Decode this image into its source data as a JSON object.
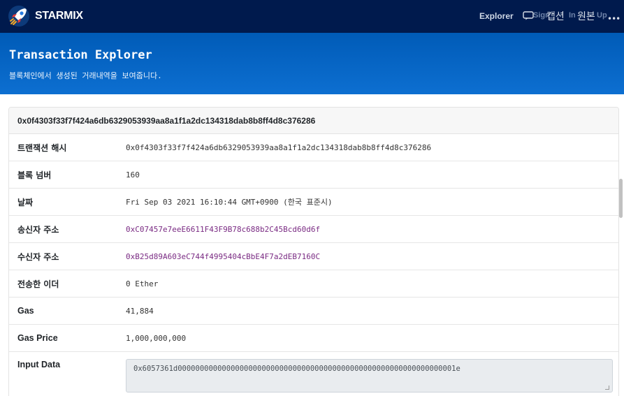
{
  "navbar": {
    "brand": "STARMIX",
    "explorer_label": "Explorer",
    "overlap_a": "Sign",
    "caption_ko": "캡션",
    "overlap_b": "In",
    "original_ko": "원본",
    "overlap_c": "Up",
    "more": "•••",
    "accent": "#001a4d"
  },
  "hero": {
    "title": "Transaction Explorer",
    "subtitle": "블록체인에서 생성된 거래내역을 보여줍니다.",
    "accent": "#0066cc"
  },
  "transaction": {
    "header": "0x0f4303f33f7f424a6db6329053939aa8a1f1a2dc134318dab8b8ff4d8c376286",
    "rows": [
      {
        "label": "트랜잭션 해시",
        "value": "0x0f4303f33f7f424a6db6329053939aa8a1f1a2dc134318dab8b8ff4d8c376286"
      },
      {
        "label": "블록 넘버",
        "value": "160"
      },
      {
        "label": "날짜",
        "value": "Fri Sep 03 2021 16:10:44 GMT+0900 (한국 표준시)"
      },
      {
        "label": "송신자 주소",
        "value": "0xC07457e7eeE6611F43F9B78c688b2C45Bcd60d6f"
      },
      {
        "label": "수신자 주소",
        "value": "0xB25d89A603eC744f4995404cBbE4F7a2dEB7160C"
      },
      {
        "label": "전송한 이더",
        "value": "0 Ether"
      },
      {
        "label": "Gas",
        "value": "41,884"
      },
      {
        "label": "Gas Price",
        "value": "1,000,000,000"
      }
    ],
    "input_label": "Input Data",
    "input_value": "0x6057361d000000000000000000000000000000000000000000000000000000000000001e"
  }
}
